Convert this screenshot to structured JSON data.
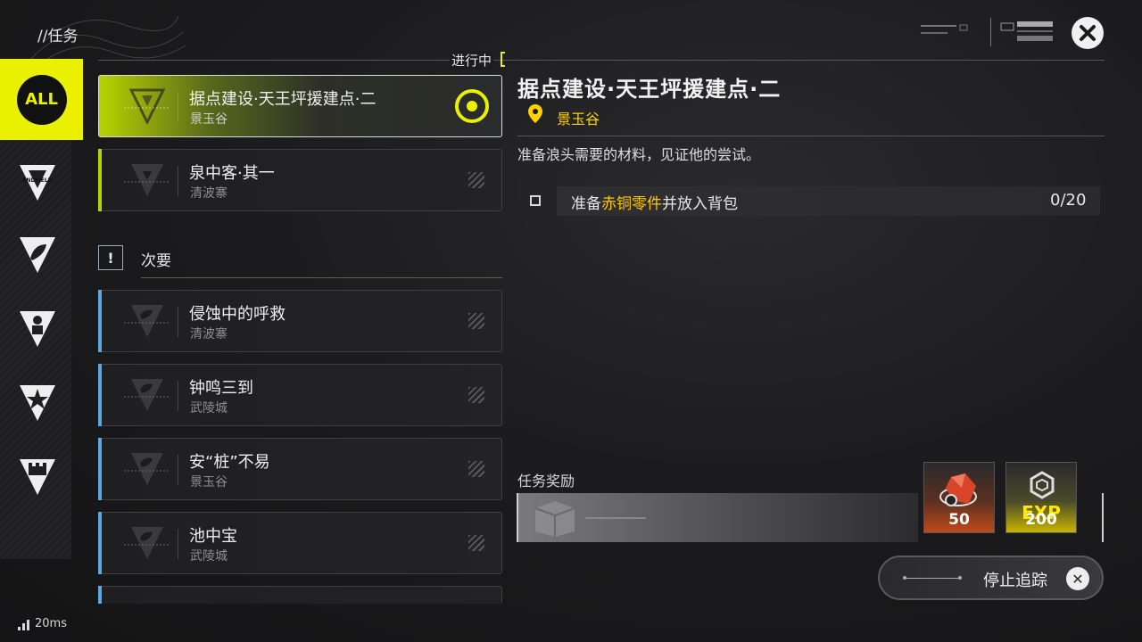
{
  "header": {
    "breadcrumb": "//任务"
  },
  "sidebar": {
    "all_label": "ALL",
    "tabs": [
      {
        "name": "endfield",
        "label": "ENDFIELD"
      },
      {
        "name": "leaf"
      },
      {
        "name": "person"
      },
      {
        "name": "star"
      },
      {
        "name": "castle"
      }
    ]
  },
  "sections": {
    "in_progress": "进行中",
    "secondary": "次要",
    "secondary_icon": "!"
  },
  "active_quests": [
    {
      "title": "据点建设·天王坪援建点·二",
      "location": "景玉谷"
    },
    {
      "title": "泉中客·其一",
      "location": "清波寨"
    }
  ],
  "secondary_quests": [
    {
      "title": "侵蚀中的呼救",
      "location": "清波寨"
    },
    {
      "title": "钟鸣三到",
      "location": "武陵城"
    },
    {
      "title": "安“桩”不易",
      "location": "景玉谷"
    },
    {
      "title": "池中宝",
      "location": "武陵城"
    }
  ],
  "detail": {
    "title": "据点建设·天王坪援建点·二",
    "location": "景玉谷",
    "description": "准备浪头需要的材料，见证他的尝试。",
    "objective": {
      "prefix": "准备",
      "highlight": "赤铜零件",
      "suffix": "并放入背包",
      "progress": "0/20"
    }
  },
  "rewards": {
    "title": "任务奖励",
    "items": [
      {
        "icon": "crystal-icon",
        "quantity": "50"
      },
      {
        "icon": "exp-icon",
        "label": "EXP",
        "quantity": "200"
      }
    ]
  },
  "actions": {
    "stop_tracking": "停止追踪"
  },
  "status": {
    "ping": "20ms"
  },
  "colors": {
    "accent": "#e9f000",
    "highlight": "#ffc800",
    "secondary_bar": "#5aa8e0"
  }
}
